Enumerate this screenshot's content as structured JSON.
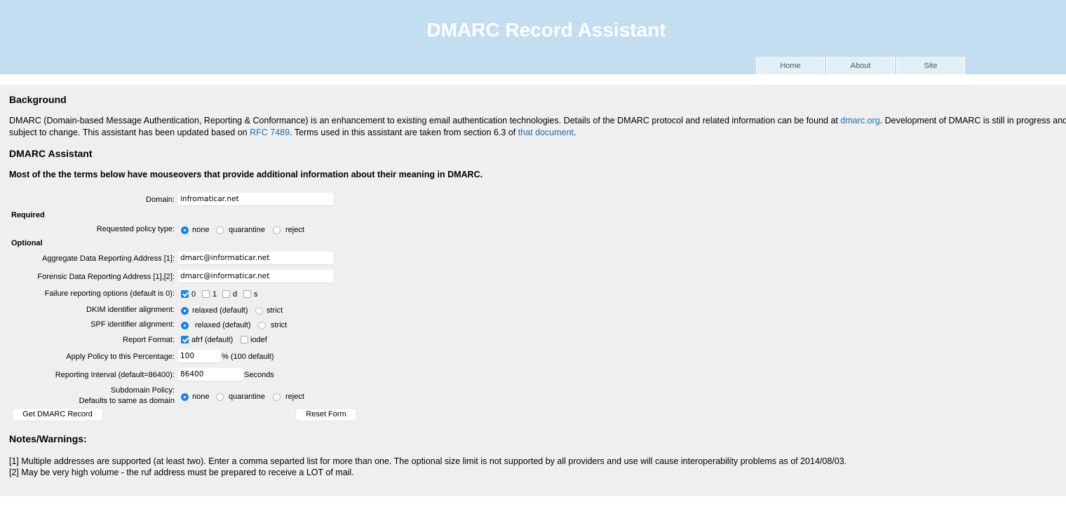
{
  "header": {
    "title": "DMARC Record Assistant",
    "nav": [
      "Home",
      "About",
      "Site"
    ]
  },
  "background": {
    "heading": "Background",
    "text1": "DMARC (Domain-based Message Authentication, Reporting & Conformance) is an enhancement to existing email authentication technologies. Details of the DMARC protocol and related information can be found at ",
    "link1": "dmarc.org",
    "text2": ". Development of DMARC is still in progress and subject to change. This assistant has been updated based on ",
    "link2": "RFC 7489",
    "text3": ". Terms used in this assistant are taken from section 6.3 of ",
    "link3": "that document",
    "text4": "."
  },
  "assistant": {
    "heading": "DMARC Assistant",
    "subheading": "Most of the the terms below have mouseovers that provide additional information about their meaning in DMARC."
  },
  "form": {
    "domain_label": "Domain:",
    "domain_value": "infromaticar.net",
    "required_label": "Required",
    "policy_label": "Requested policy type:",
    "policy_options": [
      "none",
      "quarantine",
      "reject"
    ],
    "policy_selected": "none",
    "optional_label": "Optional",
    "rua_label": "Aggregate Data Reporting Address [1]:",
    "rua_value": "dmarc@informaticar.net",
    "ruf_label": "Forensic Data Reporting Address [1],[2]:",
    "ruf_value": "dmarc@informaticar.net",
    "fo_label": "Failure reporting options (default is 0):",
    "fo_options": [
      "0",
      "1",
      "d",
      "s"
    ],
    "fo_checked": [
      "0"
    ],
    "dkim_label": "DKIM identifier alignment:",
    "dkim_options": [
      "relaxed (default)",
      "strict"
    ],
    "dkim_selected": "relaxed (default)",
    "spf_label": "SPF identifier alignment:",
    "spf_options": [
      "relaxed (default)",
      "strict"
    ],
    "spf_selected": "relaxed (default)",
    "rf_label": "Report Format:",
    "rf_options": [
      "afrf (default)",
      "iodef"
    ],
    "rf_checked": [
      "afrf (default)"
    ],
    "pct_label": "Apply Policy to this Percentage:",
    "pct_value": "100",
    "pct_suffix": "% (100 default)",
    "ri_label": "Reporting Interval (default=86400):",
    "ri_value": "86400",
    "ri_suffix": "Seconds",
    "sp_label_1": "Subdomain Policy:",
    "sp_label_2": "Defaults to same as domain",
    "sp_options": [
      "none",
      "quarantine",
      "reject"
    ],
    "sp_selected": "none",
    "get_button": "Get DMARC Record",
    "reset_button": "Reset Form"
  },
  "notes": {
    "heading": "Notes/Warnings:",
    "note1": "[1] Multiple addresses are supported (at least two). Enter a comma separted list for more than one. The optional size limit is not supported by all providers and use will cause interoperability problems as of 2014/08/03.",
    "note2": "[2] May be very high volume - the ruf address must be prepared to receive a LOT of mail."
  },
  "colors": {
    "header_bg": "#c3def0",
    "content_bg": "#efefef",
    "link": "#1a6fb5",
    "accent": "#1a82f0"
  }
}
